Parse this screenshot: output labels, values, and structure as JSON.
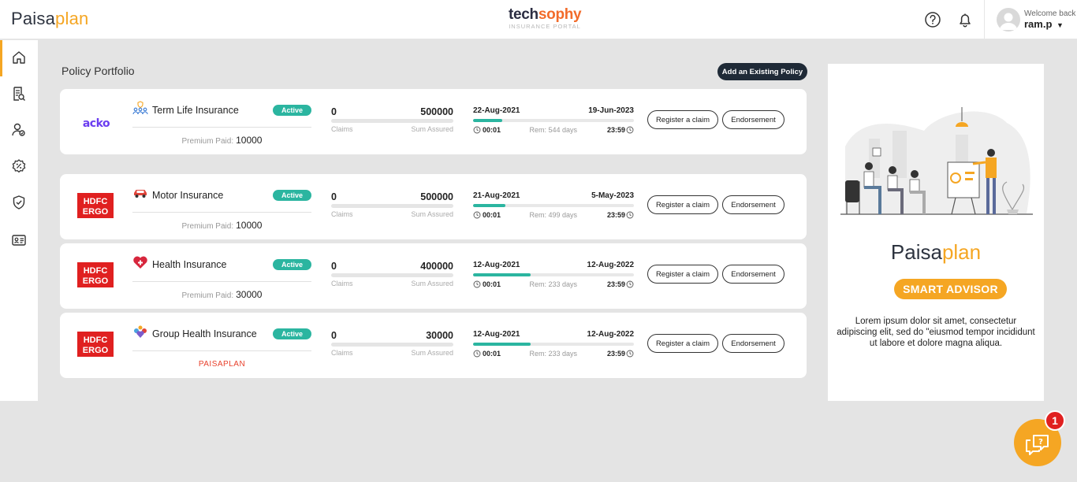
{
  "header": {
    "brand_part1": "Paisa",
    "brand_part2": "plan",
    "center_logo_part1": "tech",
    "center_logo_part2": "sophy",
    "center_logo_sub": "INSURANCE PORTAL",
    "welcome_text": "Welcome back",
    "username": "ram.p"
  },
  "sidebar": {
    "items": [
      {
        "icon": "home-icon"
      },
      {
        "icon": "policy-document-icon"
      },
      {
        "icon": "user-settings-icon"
      },
      {
        "icon": "discount-icon"
      },
      {
        "icon": "shield-check-icon"
      },
      {
        "icon": "id-card-icon"
      }
    ]
  },
  "main": {
    "title": "Policy Portfolio",
    "add_button": "Add an Existing Policy"
  },
  "policies": [
    {
      "insurer_logo": "ACKO",
      "name": "Term Life Insurance",
      "status": "Active",
      "premium_label": "Premium Paid:",
      "premium_value": "10000",
      "claims_value": "0",
      "claims_label": "Claims",
      "sum_value": "500000",
      "sum_label": "Sum Assured",
      "start_date": "22-Aug-2021",
      "end_date": "19-Jun-2023",
      "progress": 0.18,
      "time_left": "00:01",
      "remaining": "Rem: 544 days",
      "time_right": "23:59",
      "claim_button": "Register a claim",
      "endorse_button": "Endorsement"
    },
    {
      "insurer_logo": "HDFC ERGO",
      "name": "Motor Insurance",
      "status": "Active",
      "premium_label": "Premium Paid:",
      "premium_value": "10000",
      "claims_value": "0",
      "claims_label": "Claims",
      "sum_value": "500000",
      "sum_label": "Sum Assured",
      "start_date": "21-Aug-2021",
      "end_date": "5-May-2023",
      "progress": 0.2,
      "time_left": "00:01",
      "remaining": "Rem: 499 days",
      "time_right": "23:59",
      "claim_button": "Register a claim",
      "endorse_button": "Endorsement"
    },
    {
      "insurer_logo": "HDFC ERGO",
      "name": "Health Insurance",
      "status": "Active",
      "premium_label": "Premium Paid:",
      "premium_value": "30000",
      "claims_value": "0",
      "claims_label": "Claims",
      "sum_value": "400000",
      "sum_label": "Sum Assured",
      "start_date": "12-Aug-2021",
      "end_date": "12-Aug-2022",
      "progress": 0.36,
      "time_left": "00:01",
      "remaining": "Rem: 233 days",
      "time_right": "23:59",
      "claim_button": "Register a claim",
      "endorse_button": "Endorsement"
    },
    {
      "insurer_logo": "HDFC ERGO",
      "name": "Group Health Insurance",
      "status": "Active",
      "group_tag": "PAISAPLAN",
      "claims_value": "0",
      "claims_label": "Claims",
      "sum_value": "30000",
      "sum_label": "Sum Assured",
      "start_date": "12-Aug-2021",
      "end_date": "12-Aug-2022",
      "progress": 0.36,
      "time_left": "00:01",
      "remaining": "Rem: 233 days",
      "time_right": "23:59",
      "claim_button": "Register a claim",
      "endorse_button": "Endorsement"
    }
  ],
  "right_panel": {
    "brand_part1": "Paisa",
    "brand_part2": "plan",
    "badge": "SMART ADVISOR",
    "text": "Lorem ipsum dolor sit amet, consectetur adipiscing elit, sed do \"eiusmod tempor incididunt ut labore et dolore magna aliqua."
  },
  "chat": {
    "badge_count": "1",
    "icon": "chat-help-icon"
  },
  "colors": {
    "accent": "#f5a623",
    "active": "#2bb5a0",
    "dark": "#1f2a37",
    "hdfc_red": "#e02020",
    "acko_purple": "#6b3df0"
  }
}
